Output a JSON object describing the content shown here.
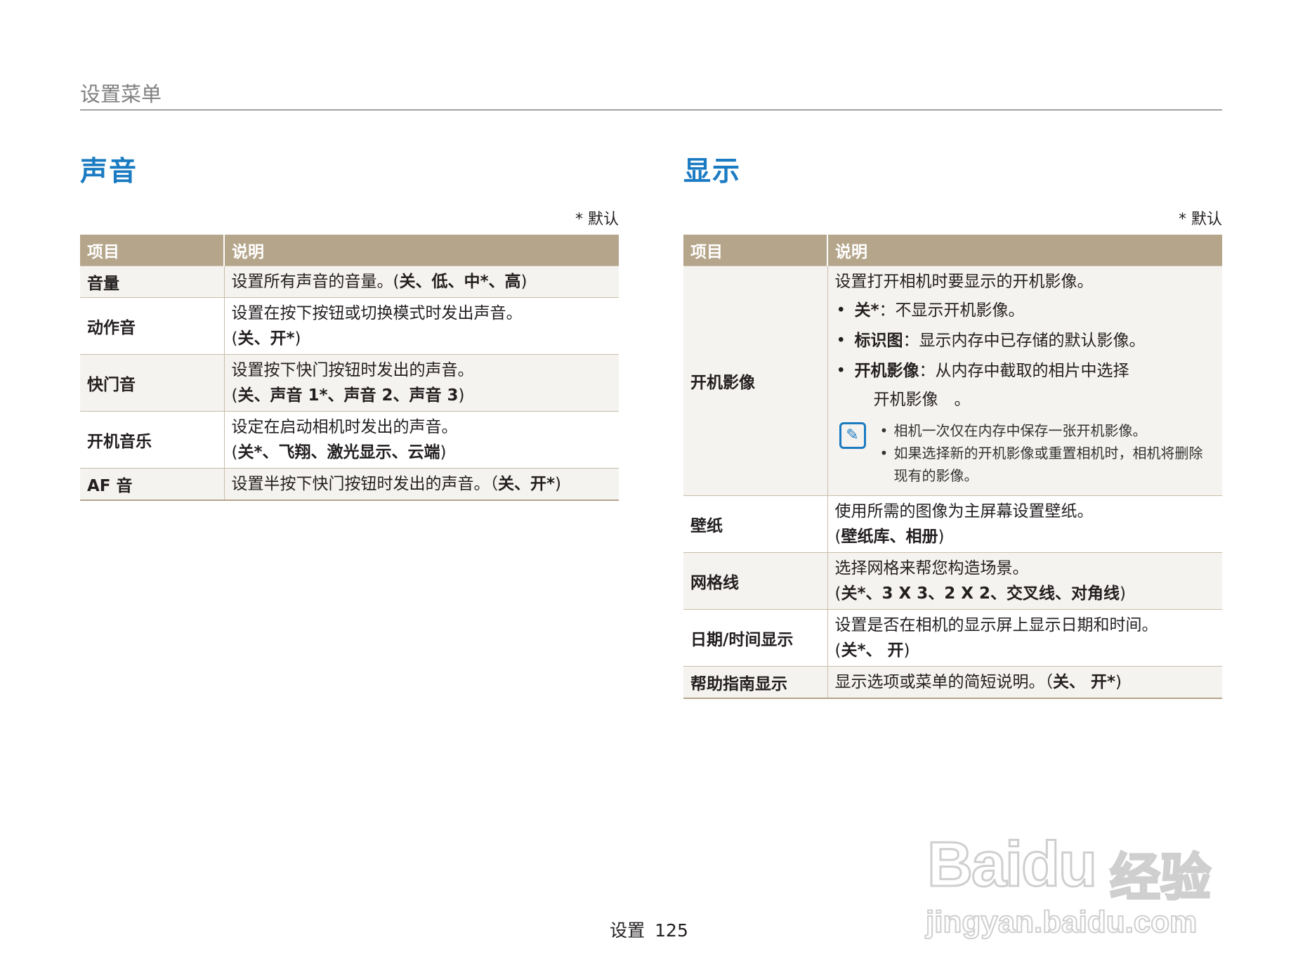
{
  "header": {
    "title": "设置菜单"
  },
  "sound": {
    "title": "声音",
    "default_note": "* 默认",
    "col_item": "项目",
    "col_desc": "说明",
    "rows": [
      {
        "item": "音量",
        "desc": "设置所有声音的音量。(",
        "opts": "关、低、中*、高",
        "close": ")"
      },
      {
        "item": "动作音",
        "desc": "设置在按下按钮或切换模式时发出声音。",
        "opts": "关、开*",
        "open": "(",
        "close": ")"
      },
      {
        "item": "快门音",
        "desc": "设置按下快门按钮时发出的声音。",
        "opts": "关、声音 1*、声音 2、声音 3",
        "open": "(",
        "close": ")"
      },
      {
        "item": "开机音乐",
        "desc": "设定在启动相机时发出的声音。",
        "opts": "关*、飞翔、激光显示、云端",
        "open": "(",
        "close": ")"
      },
      {
        "item": "AF 音",
        "desc": "设置半按下快门按钮时发出的声音。（",
        "opts": "关、开*",
        "close": ")"
      }
    ]
  },
  "display": {
    "title": "显示",
    "default_note": "* 默认",
    "col_item": "项目",
    "col_desc": "说明",
    "startup": {
      "item": "开机影像",
      "intro": "设置打开相机时要显示的开机影像。",
      "bullets": [
        {
          "label": "关*",
          "text": "：不显示开机影像。"
        },
        {
          "label": "标识图",
          "text": "：显示内存中已存储的默认影像。"
        },
        {
          "label": "开机影像",
          "text": "：从内存中截取的相片中选择"
        }
      ],
      "bullet3_cont": "开机影像　。",
      "notes": [
        "相机一次仅在内存中保存一张开机影像。",
        "如果选择新的开机影像或重置相机时，相机将删除现有的影像。"
      ]
    },
    "rows": [
      {
        "item": "壁纸",
        "desc": "使用所需的图像为主屏幕设置壁纸。",
        "opts": "壁纸库、相册",
        "open": "(",
        "close": ")"
      },
      {
        "item": "网格线",
        "desc": "选择网格来帮您构造场景。",
        "opts": "关*、3 X 3、2 X 2、交叉线、对角线",
        "open": "(",
        "close": ")"
      },
      {
        "item": "日期/时间显示",
        "desc": "设置是否在相机的显示屏上显示日期和时间。",
        "opts": "关*、 开",
        "open": "(",
        "close": ")"
      },
      {
        "item": "帮助指南显示",
        "desc": "显示选项或菜单的简短说明。（",
        "opts": "关、 开*",
        "close": ")"
      }
    ]
  },
  "footer": {
    "label": "设置",
    "page": "125"
  },
  "watermark": {
    "brand": "Baidu",
    "cn": "经验",
    "url": "jingyan.baidu.com"
  }
}
